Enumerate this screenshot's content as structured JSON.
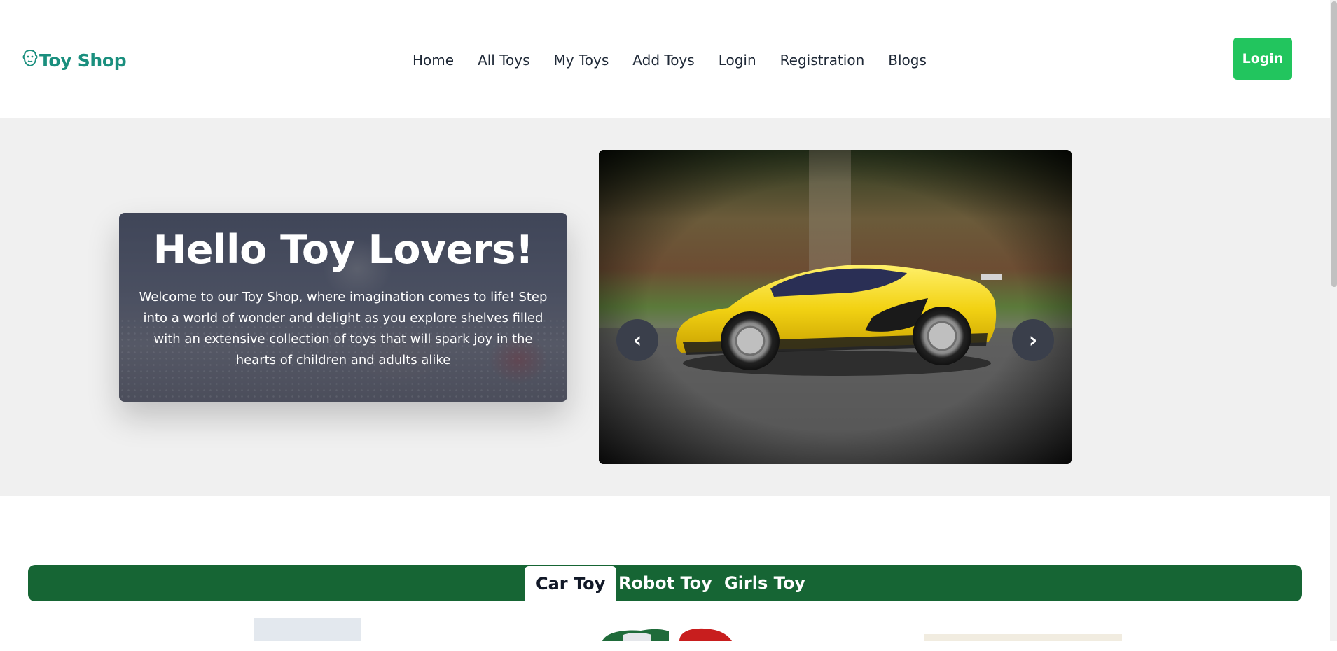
{
  "brand": {
    "name": "Toy Shop",
    "icon": "lion-head-icon",
    "color": "#1a8f7e"
  },
  "nav": {
    "items": [
      {
        "label": "Home"
      },
      {
        "label": "All Toys"
      },
      {
        "label": "My Toys"
      },
      {
        "label": "Add Toys"
      },
      {
        "label": "Login"
      },
      {
        "label": "Registration"
      },
      {
        "label": "Blogs"
      }
    ],
    "login_button": "Login",
    "login_button_color": "#22c55e"
  },
  "hero": {
    "title": "Hello Toy Lovers!",
    "text": "Welcome to our Toy Shop, where imagination comes to life! Step into a world of wonder and delight as you explore shelves filled with an extensive collection of toys that will spark joy in the hearts of children and adults alike",
    "slider": {
      "prev_label": "‹",
      "next_label": "›"
    }
  },
  "tabs": {
    "items": [
      {
        "label": "Car Toy",
        "active": true
      },
      {
        "label": "Robot Toy",
        "active": false
      },
      {
        "label": "Girls Toy",
        "active": false
      }
    ],
    "bar_color": "#166534"
  }
}
